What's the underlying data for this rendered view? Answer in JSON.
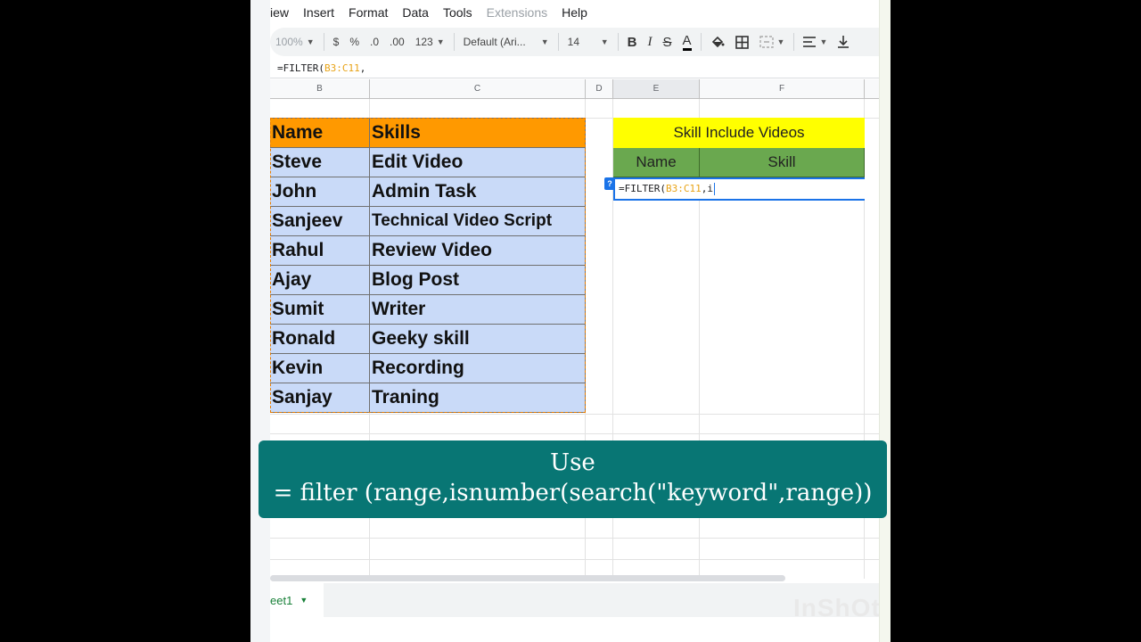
{
  "menu": [
    "View",
    "Insert",
    "Format",
    "Data",
    "Tools",
    "Extensions",
    "Help"
  ],
  "menu_cut": "iew",
  "toolbar": {
    "zoom": "100%",
    "currency": "$",
    "percent": "%",
    "dec_less": ".0",
    "dec_more": ".00",
    "format_more": "123",
    "font": "Default (Ari...",
    "font_size": "14",
    "bold": "B",
    "italic": "I",
    "strike": "S",
    "text_color": "A"
  },
  "formula_bar": {
    "prefix": "=FILTER(",
    "ref": "B3:C11",
    "suffix": ", "
  },
  "columns": [
    "B",
    "C",
    "D",
    "E",
    "F"
  ],
  "left_table": {
    "headers": [
      "Name",
      "Skills"
    ],
    "rows": [
      [
        "Steve",
        "Edit Video"
      ],
      [
        "John",
        "Admin Task"
      ],
      [
        "Sanjeev",
        "Technical Video Script"
      ],
      [
        "Rahul",
        "Review Video"
      ],
      [
        "Ajay",
        "Blog Post"
      ],
      [
        "Sumit",
        "Writer"
      ],
      [
        "Ronald",
        "Geeky skill"
      ],
      [
        "Kevin",
        "Recording"
      ],
      [
        "Sanjay",
        "Traning"
      ]
    ]
  },
  "right_table": {
    "title": "Skill Include Videos",
    "headers": [
      "Name",
      "Skill"
    ],
    "active_cell": {
      "prefix": "=FILTER(",
      "ref": "B3:C11",
      "suffix": ",i"
    },
    "help_badge": "?"
  },
  "banner": {
    "line1": "Use",
    "line2": "= filter (range,isnumber(search(\"keyword\",range))"
  },
  "sheet_tab": "eet1",
  "watermark": "InShOt",
  "colors": {
    "header_orange": "#ff9900",
    "body_blue": "#c9daf8",
    "title_yellow": "#ffff00",
    "header_green": "#6aa84f",
    "banner_teal": "#087674",
    "selection_blue": "#1a73e8"
  }
}
